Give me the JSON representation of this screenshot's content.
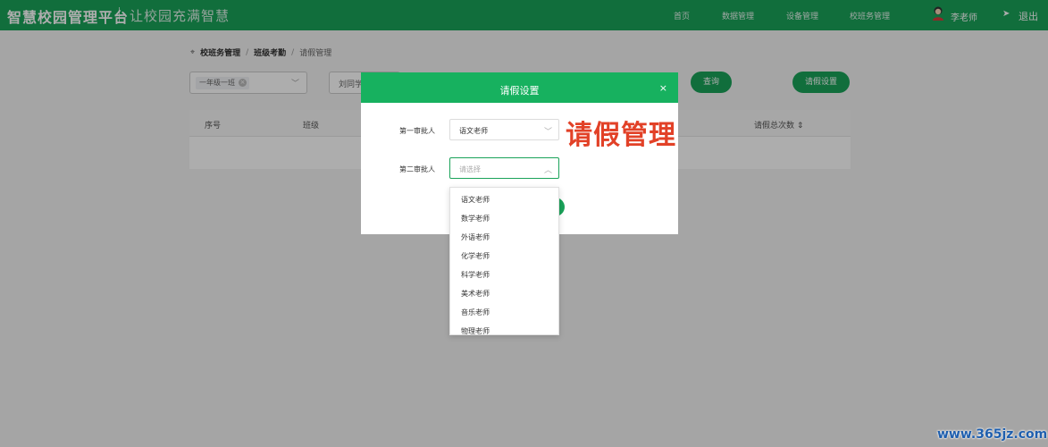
{
  "header": {
    "brand": "智慧校园管理平台",
    "slogan": "让校园充满智慧",
    "nav": [
      "首页",
      "数据管理",
      "设备管理",
      "校班务管理"
    ],
    "user_name": "李老师",
    "logout": "退出"
  },
  "breadcrumb": {
    "items": [
      "校班务管理",
      "班级考勤",
      "请假管理"
    ]
  },
  "filters": {
    "class_tag": "一年级一班",
    "student_value": "刘同学"
  },
  "buttons": {
    "query": "查询",
    "leave_settings": "请假设置"
  },
  "table": {
    "headers": [
      "序号",
      "班级",
      "请假总次数"
    ]
  },
  "modal": {
    "title": "请假设置",
    "close": "×",
    "first_approver_label": "第一审批人",
    "first_approver_value": "语文老师",
    "second_approver_label": "第二审批人",
    "second_approver_placeholder": "请选择",
    "dropdown_options": [
      "语文老师",
      "数学老师",
      "外语老师",
      "化学老师",
      "科学老师",
      "美术老师",
      "音乐老师",
      "物理老师"
    ]
  },
  "overlay_text": "请假管理",
  "site_mark": "www.365jz.com",
  "colors": {
    "primary": "#1aa259",
    "modal_header": "#17b15f",
    "accent_text": "#e24127"
  }
}
